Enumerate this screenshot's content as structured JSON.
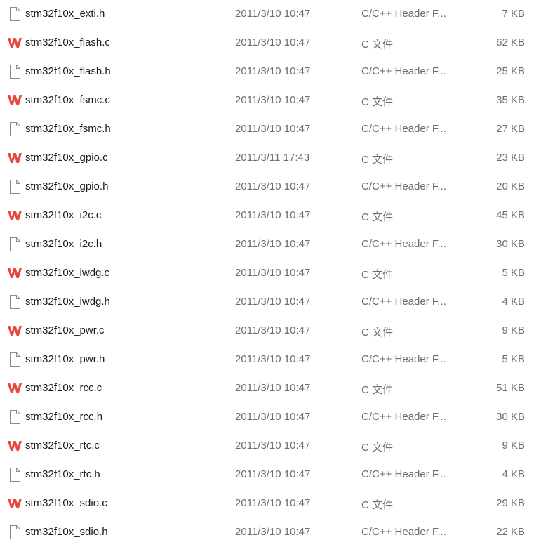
{
  "files": [
    {
      "name": "stm32f10x_exti.h",
      "date": "2011/3/10 10:47",
      "type": "C/C++ Header F...",
      "size": "7 KB",
      "icon": "blank-file-icon"
    },
    {
      "name": "stm32f10x_flash.c",
      "date": "2011/3/10 10:47",
      "type": "C 文件",
      "size": "62 KB",
      "icon": "wps-c-file-icon"
    },
    {
      "name": "stm32f10x_flash.h",
      "date": "2011/3/10 10:47",
      "type": "C/C++ Header F...",
      "size": "25 KB",
      "icon": "blank-file-icon"
    },
    {
      "name": "stm32f10x_fsmc.c",
      "date": "2011/3/10 10:47",
      "type": "C 文件",
      "size": "35 KB",
      "icon": "wps-c-file-icon"
    },
    {
      "name": "stm32f10x_fsmc.h",
      "date": "2011/3/10 10:47",
      "type": "C/C++ Header F...",
      "size": "27 KB",
      "icon": "blank-file-icon"
    },
    {
      "name": "stm32f10x_gpio.c",
      "date": "2011/3/11 17:43",
      "type": "C 文件",
      "size": "23 KB",
      "icon": "wps-c-file-icon"
    },
    {
      "name": "stm32f10x_gpio.h",
      "date": "2011/3/10 10:47",
      "type": "C/C++ Header F...",
      "size": "20 KB",
      "icon": "blank-file-icon"
    },
    {
      "name": "stm32f10x_i2c.c",
      "date": "2011/3/10 10:47",
      "type": "C 文件",
      "size": "45 KB",
      "icon": "wps-c-file-icon"
    },
    {
      "name": "stm32f10x_i2c.h",
      "date": "2011/3/10 10:47",
      "type": "C/C++ Header F...",
      "size": "30 KB",
      "icon": "blank-file-icon"
    },
    {
      "name": "stm32f10x_iwdg.c",
      "date": "2011/3/10 10:47",
      "type": "C 文件",
      "size": "5 KB",
      "icon": "wps-c-file-icon"
    },
    {
      "name": "stm32f10x_iwdg.h",
      "date": "2011/3/10 10:47",
      "type": "C/C++ Header F...",
      "size": "4 KB",
      "icon": "blank-file-icon"
    },
    {
      "name": "stm32f10x_pwr.c",
      "date": "2011/3/10 10:47",
      "type": "C 文件",
      "size": "9 KB",
      "icon": "wps-c-file-icon"
    },
    {
      "name": "stm32f10x_pwr.h",
      "date": "2011/3/10 10:47",
      "type": "C/C++ Header F...",
      "size": "5 KB",
      "icon": "blank-file-icon"
    },
    {
      "name": "stm32f10x_rcc.c",
      "date": "2011/3/10 10:47",
      "type": "C 文件",
      "size": "51 KB",
      "icon": "wps-c-file-icon"
    },
    {
      "name": "stm32f10x_rcc.h",
      "date": "2011/3/10 10:47",
      "type": "C/C++ Header F...",
      "size": "30 KB",
      "icon": "blank-file-icon"
    },
    {
      "name": "stm32f10x_rtc.c",
      "date": "2011/3/10 10:47",
      "type": "C 文件",
      "size": "9 KB",
      "icon": "wps-c-file-icon"
    },
    {
      "name": "stm32f10x_rtc.h",
      "date": "2011/3/10 10:47",
      "type": "C/C++ Header F...",
      "size": "4 KB",
      "icon": "blank-file-icon"
    },
    {
      "name": "stm32f10x_sdio.c",
      "date": "2011/3/10 10:47",
      "type": "C 文件",
      "size": "29 KB",
      "icon": "wps-c-file-icon"
    },
    {
      "name": "stm32f10x_sdio.h",
      "date": "2011/3/10 10:47",
      "type": "C/C++ Header F...",
      "size": "22 KB",
      "icon": "blank-file-icon"
    }
  ],
  "colors": {
    "wps_icon": "#e8453c",
    "file_outline": "#8a8a8a",
    "name_text": "#1a1a1a",
    "meta_text": "#6d6d6d"
  }
}
